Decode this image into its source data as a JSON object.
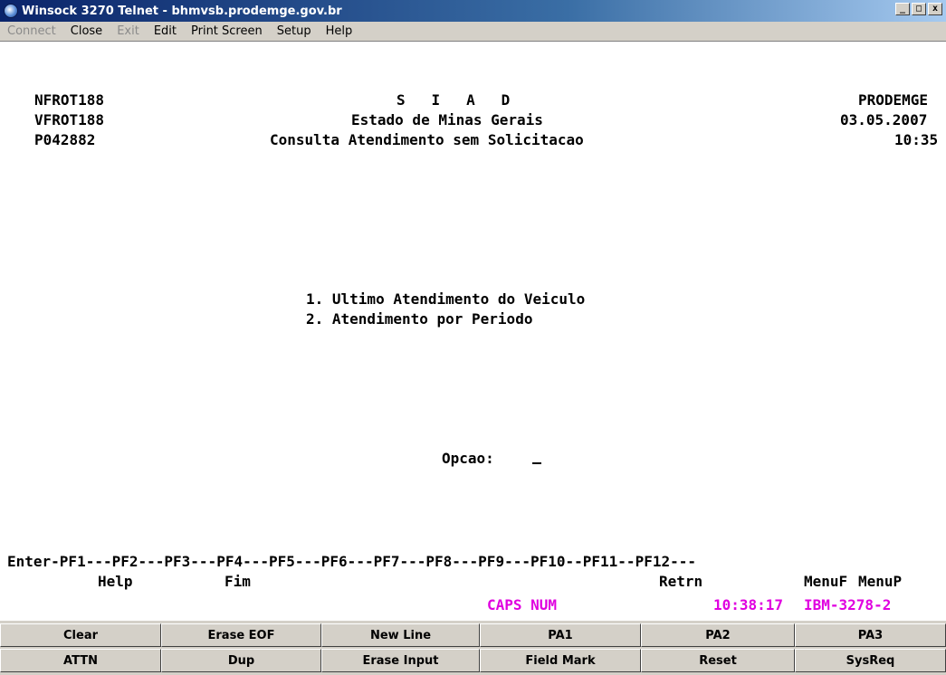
{
  "window": {
    "title": "Winsock 3270 Telnet - bhmvsb.prodemge.gov.br",
    "controls": [
      "_",
      "□",
      "x"
    ]
  },
  "menu": {
    "items": [
      {
        "label": "Connect",
        "disabled": true
      },
      {
        "label": "Close",
        "disabled": false
      },
      {
        "label": "Exit",
        "disabled": true
      },
      {
        "label": "Edit",
        "disabled": false
      },
      {
        "label": "Print Screen",
        "disabled": false
      },
      {
        "label": "Setup",
        "disabled": false
      },
      {
        "label": "Help",
        "disabled": false
      }
    ]
  },
  "terminal": {
    "header": {
      "program": "NFROT188",
      "screen_id": "VFROT188",
      "user_id": "P042882",
      "system": "S   I   A   D",
      "state": "Estado de Minas Gerais",
      "screen_title": "Consulta Atendimento sem Solicitacao",
      "company": "PRODEMGE",
      "date": "03.05.2007",
      "time": "10:35"
    },
    "options": [
      "1. Ultimo Atendimento do Veiculo",
      "2. Atendimento por Periodo"
    ],
    "prompt_label": "Opcao:",
    "pf_line": "Enter-PF1---PF2---PF3---PF4---PF5---PF6---PF7---PF8---PF9---PF10--PF11--PF12---",
    "pf_labels": {
      "help": "Help",
      "fim": "Fim",
      "retrn": "Retrn",
      "menuf": "MenuF",
      "menup": "MenuP"
    },
    "status": {
      "indicators": "CAPS NUM",
      "clock": "10:38:17",
      "terminal_type": "IBM-3278-2"
    }
  },
  "keypad": {
    "row1": [
      "Clear",
      "Erase EOF",
      "New Line",
      "PA1",
      "PA2",
      "PA3"
    ],
    "row2": [
      "ATTN",
      "Dup",
      "Erase Input",
      "Field Mark",
      "Reset",
      "SysReq"
    ]
  },
  "colors": {
    "titlebar": "#0a246a",
    "status_magenta": "#e000e0",
    "screen_bg": "#ffffff"
  }
}
